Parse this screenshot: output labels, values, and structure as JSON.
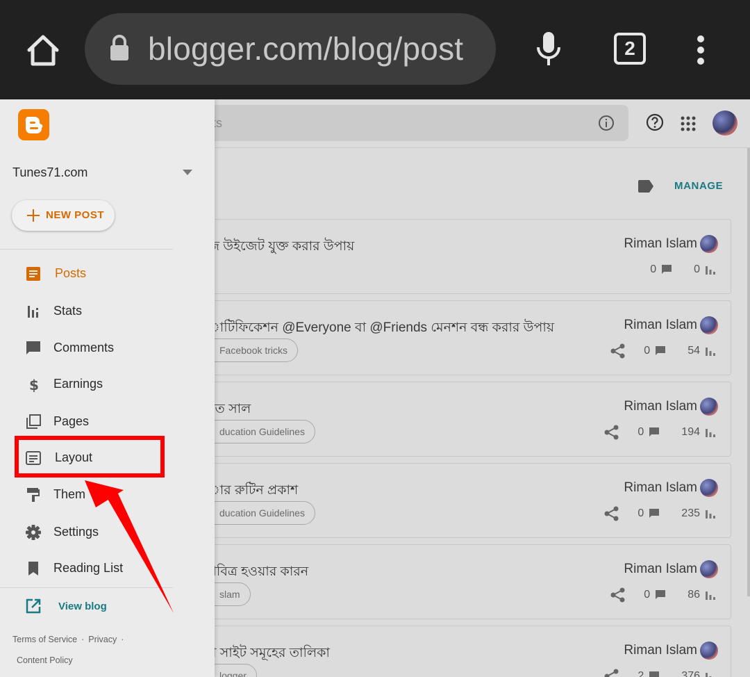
{
  "browser": {
    "url": "blogger.com/blog/post",
    "tab_count": "2",
    "icons": [
      "home-icon",
      "lock-icon",
      "mic-icon",
      "tab-switcher-icon",
      "more-vert-icon"
    ]
  },
  "topbar": {
    "search_placeholder": "ts",
    "icons": [
      "info-icon",
      "help-icon",
      "apps-icon",
      "account-avatar"
    ]
  },
  "drawer": {
    "blog_name": "Tunes71.com",
    "new_post_label": "NEW POST",
    "nav": [
      {
        "label": "Posts",
        "icon": "posts-icon",
        "active": true
      },
      {
        "label": "Stats",
        "icon": "stats-icon",
        "active": false
      },
      {
        "label": "Comments",
        "icon": "comments-icon",
        "active": false
      },
      {
        "label": "Earnings",
        "icon": "dollar-icon",
        "active": false
      },
      {
        "label": "Pages",
        "icon": "pages-icon",
        "active": false
      },
      {
        "label": "Layout",
        "icon": "layout-icon",
        "active": false
      },
      {
        "label": "Them",
        "icon": "theme-icon",
        "active": false
      },
      {
        "label": "Settings",
        "icon": "gear-icon",
        "active": false
      },
      {
        "label": "Reading List",
        "icon": "bookmark-icon",
        "active": false
      }
    ],
    "view_blog_label": "View blog",
    "footer": {
      "terms": "Terms of Service",
      "privacy": "Privacy",
      "content_policy": "Content Policy"
    }
  },
  "main": {
    "manage_label": "MANAGE",
    "posts": [
      {
        "title": "জ উইজেট যুক্ত করার উপায়",
        "label": "",
        "author": "Riman Islam",
        "comments": "0",
        "views": "0",
        "shareable": false
      },
      {
        "title": "াটিফিকেশন @Everyone বা @Friends মেনশন বন্ধ করার উপায়",
        "label": "Facebook tricks",
        "author": "Riman Islam",
        "comments": "0",
        "views": "54",
        "shareable": true
      },
      {
        "title": "মৃত সাল",
        "label": "ducation Guidelines",
        "author": "Riman Islam",
        "comments": "0",
        "views": "194",
        "shareable": true
      },
      {
        "title": "ার রুটিন প্রকাশ",
        "label": "ducation Guidelines",
        "author": "Riman Islam",
        "comments": "0",
        "views": "235",
        "shareable": true
      },
      {
        "title": "পবিত্র হওয়ার কারন",
        "label": "slam",
        "author": "Riman Islam",
        "comments": "0",
        "views": "86",
        "shareable": true
      },
      {
        "title": "গ সাইট সমূহের তালিকা",
        "label": "logger",
        "author": "Riman Islam",
        "comments": "2",
        "views": "376",
        "shareable": true
      }
    ]
  },
  "annotation": {
    "highlight_color": "#ff0000",
    "highlighted_item": "Layout"
  },
  "colors": {
    "accent_orange": "#d46a00",
    "teal_link": "#1a7a83",
    "chrome_bg": "#212121"
  }
}
